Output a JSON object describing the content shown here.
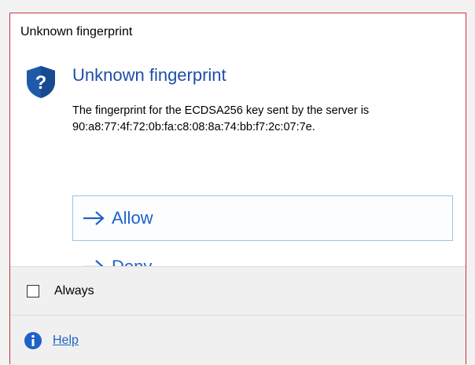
{
  "window": {
    "title": "Unknown fingerprint"
  },
  "main": {
    "heading": "Unknown fingerprint",
    "body_line1": "The fingerprint for the ECDSA256 key sent by the server is",
    "body_line2": "90:a8:77:4f:72:0b:fa:c8:08:8a:74:bb:f7:2c:07:7e."
  },
  "commands": {
    "allow_label": "Allow",
    "deny_label": "Deny"
  },
  "footer": {
    "checkbox_label": "Always",
    "checkbox_checked": false,
    "help_label": "Help"
  },
  "icons": {
    "header": "shield-question-icon",
    "command": "arrow-right-icon",
    "help": "info-icon"
  },
  "colors": {
    "accent": "#1e62c8",
    "heading": "#1f4ea8",
    "border": "#c8323c",
    "shield": "#1e5aa8"
  }
}
